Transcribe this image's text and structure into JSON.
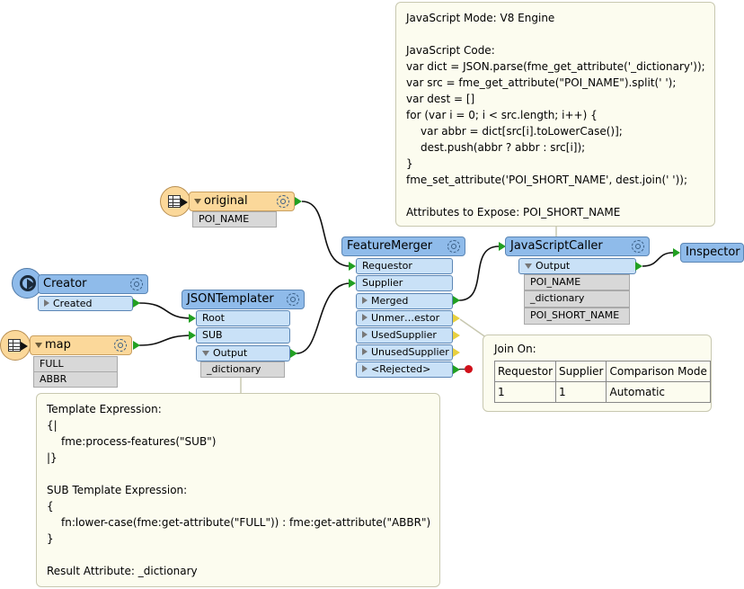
{
  "transformers": {
    "original": {
      "name": "original",
      "attrs": [
        "POI_NAME"
      ]
    },
    "map": {
      "name": "map",
      "attrs": [
        "FULL",
        "ABBR"
      ]
    },
    "creator": {
      "name": "Creator",
      "port": "Created"
    },
    "json_templater": {
      "name": "JSONTemplater",
      "ports": [
        "Root",
        "SUB",
        "Output"
      ],
      "attrs": [
        "_dictionary"
      ]
    },
    "feature_merger": {
      "name": "FeatureMerger",
      "ports": [
        "Requestor",
        "Supplier",
        "Merged",
        "Unmer…estor",
        "UsedSupplier",
        "UnusedSupplier",
        "<Rejected>"
      ]
    },
    "js_caller": {
      "name": "JavaScriptCaller",
      "port": "Output",
      "attrs": [
        "POI_NAME",
        "_dictionary",
        "POI_SHORT_NAME"
      ]
    },
    "inspector": {
      "name": "Inspector"
    }
  },
  "annotations": {
    "js": {
      "lines": [
        "JavaScript Mode: V8 Engine",
        "",
        "JavaScript Code:",
        "var dict = JSON.parse(fme_get_attribute('_dictionary'));",
        "var src = fme_get_attribute(\"POI_NAME\").split(' ');",
        "var dest = []",
        "for (var i = 0; i < src.length; i++) {",
        "var abbr = dict[src[i].toLowerCase()];",
        "dest.push(abbr ? abbr : src[i]);",
        "}",
        "fme_set_attribute('POI_SHORT_NAME', dest.join(' '));",
        "",
        "Attributes to Expose: POI_SHORT_NAME"
      ]
    },
    "template": {
      "lines": [
        "Template Expression:",
        "{|",
        "fme:process-features(\"SUB\")",
        "|}",
        "",
        "SUB Template Expression:",
        "{",
        "fn:lower-case(fme:get-attribute(\"FULL\")) : fme:get-attribute(\"ABBR\")",
        "}",
        "",
        "Result Attribute: _dictionary"
      ]
    },
    "join": {
      "title": "Join On:",
      "headers": [
        "Requestor",
        "Supplier",
        "Comparison Mode"
      ],
      "row": [
        "1",
        "1",
        "Automatic"
      ]
    }
  },
  "colors": {
    "transformer": "#8fbbea",
    "reader": "#fbd89a",
    "port": "#c9e1f7",
    "attribute": "#d8d8d8",
    "input_connector": "#22a022",
    "unused_connector": "#e8d040",
    "rejected_connector": "#d0101a",
    "annotation": "#fcfcef"
  },
  "icons": [
    "reader-icon",
    "creator-icon",
    "gear-icon",
    "collapse-triangle-icon",
    "port-triangle-icon"
  ]
}
